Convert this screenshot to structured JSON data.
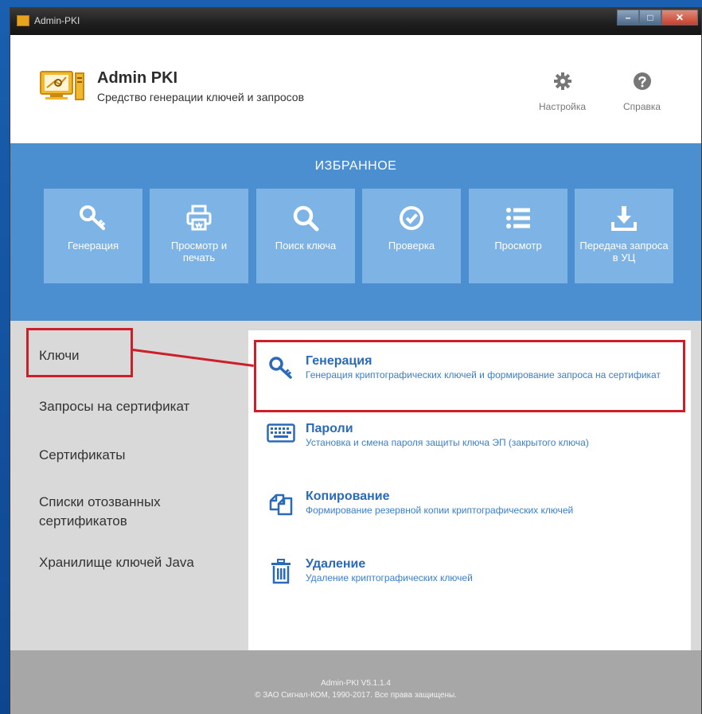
{
  "window": {
    "title": "Admin-PKI"
  },
  "header": {
    "app_name": "Admin PKI",
    "app_subtitle": "Средство генерации ключей и запросов",
    "settings_label": "Настройка",
    "help_label": "Справка"
  },
  "favorites": {
    "title": "ИЗБРАННОЕ",
    "tiles": [
      {
        "label": "Генерация",
        "icon": "key-icon"
      },
      {
        "label": "Просмотр и печать",
        "icon": "printer-icon"
      },
      {
        "label": "Поиск ключа",
        "icon": "search-icon"
      },
      {
        "label": "Проверка",
        "icon": "check-circle-icon"
      },
      {
        "label": "Просмотр",
        "icon": "list-icon"
      },
      {
        "label": "Передача запроса в УЦ",
        "icon": "download-icon"
      }
    ]
  },
  "nav": {
    "items": [
      {
        "label": "Ключи",
        "selected": true
      },
      {
        "label": "Запросы на сертификат"
      },
      {
        "label": "Сертификаты"
      },
      {
        "label": "Списки отозванных сертификатов"
      },
      {
        "label": "Хранилище ключей Java"
      }
    ]
  },
  "functions": [
    {
      "name": "Генерация",
      "desc": "Генерация криптографических ключей и формирование запроса на сертификат",
      "icon": "key-icon"
    },
    {
      "name": "Пароли",
      "desc": "Установка и смена пароля защиты ключа ЭП (закрытого ключа)",
      "icon": "keyboard-icon"
    },
    {
      "name": "Копирование",
      "desc": "Формирование резервной копии криптографических ключей",
      "icon": "copy-icon"
    },
    {
      "name": "Удаление",
      "desc": "Удаление криптографических ключей",
      "icon": "trash-icon"
    }
  ],
  "footer": {
    "version": "Admin-PKI V5.1.1.4",
    "copyright": "© ЗАО Сигнал-КОМ, 1990-2017. Все права защищены."
  },
  "colors": {
    "favorites_bg": "#4b8fd0",
    "tile_bg": "#7db3e5",
    "link_blue": "#2a6ab8",
    "highlight_red": "#cc1f2a"
  }
}
